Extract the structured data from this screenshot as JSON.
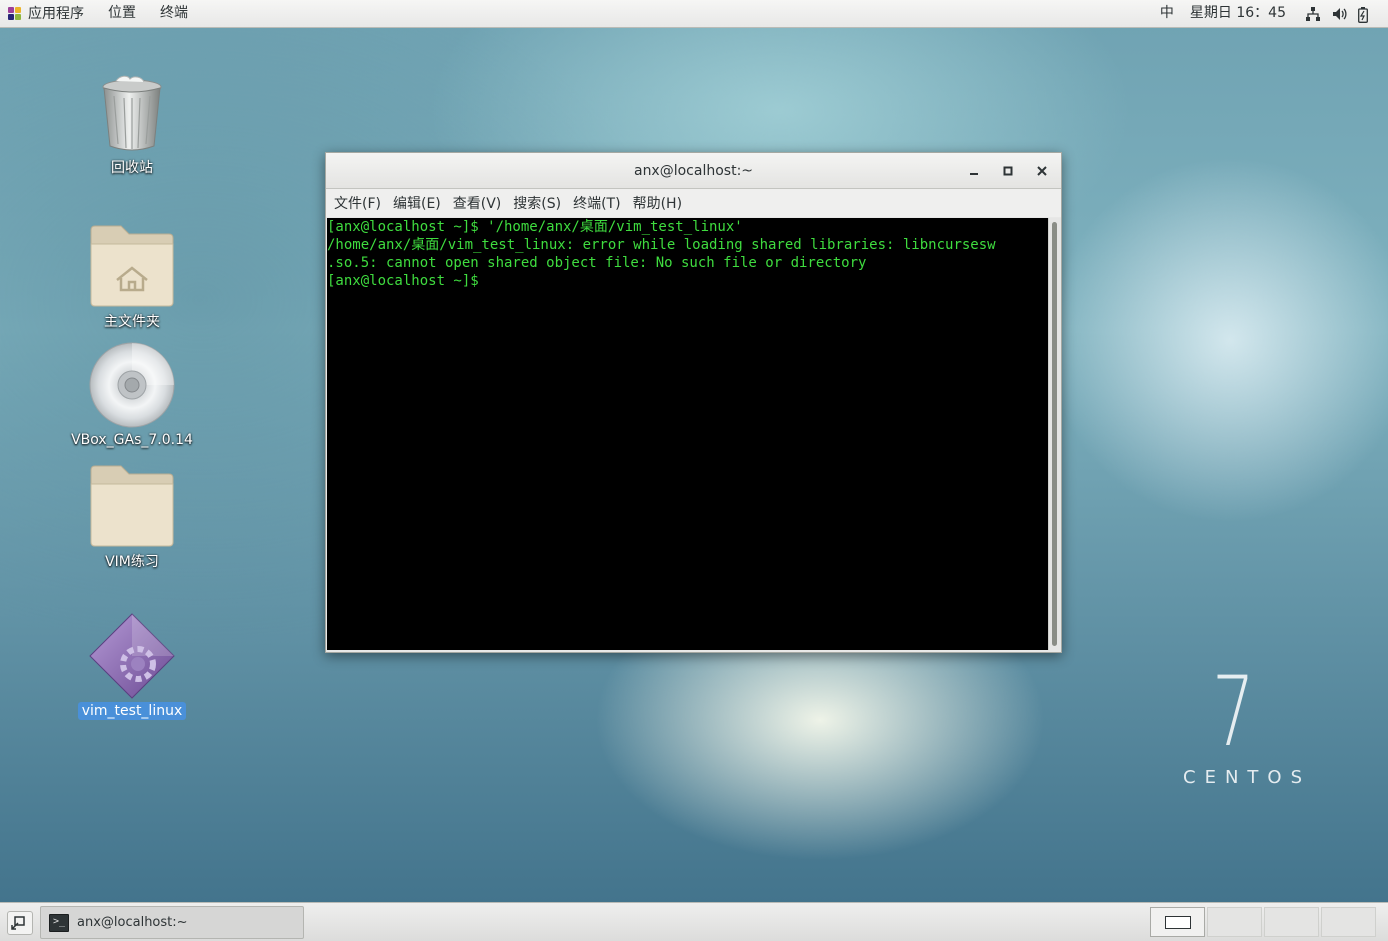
{
  "topbar": {
    "apps_label": "应用程序",
    "places_label": "位置",
    "terminal_label": "终端",
    "input_method": "中",
    "datetime": "星期日 16：45",
    "icons": [
      "network-icon",
      "volume-icon",
      "battery-icon"
    ]
  },
  "desktop": {
    "icons": [
      {
        "label": "回收站",
        "icon": "trash-icon"
      },
      {
        "label": "主文件夹",
        "icon": "home-folder-icon"
      },
      {
        "label": "VBox_GAs_7.0.14",
        "icon": "cd-icon"
      },
      {
        "label": "VIM练习",
        "icon": "folder-icon"
      },
      {
        "label": "vim_test_linux",
        "icon": "executable-icon",
        "selected": true
      }
    ]
  },
  "terminal": {
    "title": "anx@localhost:~",
    "menus": [
      "文件(F)",
      "编辑(E)",
      "查看(V)",
      "搜索(S)",
      "终端(T)",
      "帮助(H)"
    ],
    "lines": [
      "[anx@localhost ~]$ '/home/anx/桌面/vim_test_linux'",
      "/home/anx/桌面/vim_test_linux: error while loading shared libraries: libncursesw",
      ".so.5: cannot open shared object file: No such file or directory",
      "[anx@localhost ~]$ "
    ]
  },
  "watermark": {
    "number": "7",
    "word": "CENTOS"
  },
  "taskbar": {
    "window_label": "anx@localhost:~",
    "workspaces": 4
  }
}
